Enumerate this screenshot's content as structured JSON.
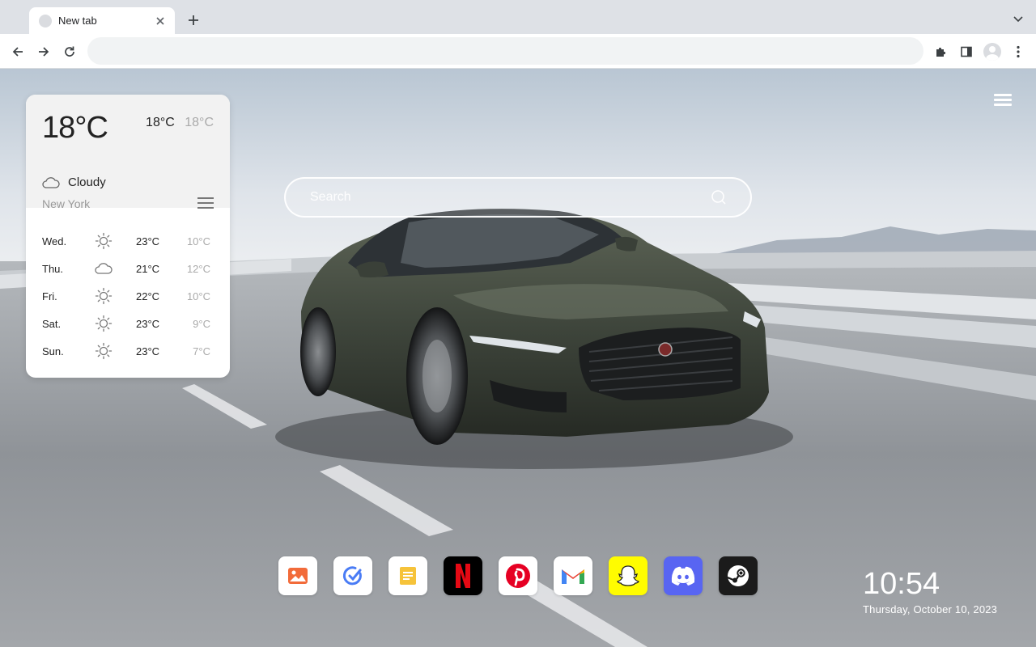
{
  "browser": {
    "tab": {
      "title": "New tab"
    },
    "omnibox": {
      "value": "",
      "placeholder": ""
    }
  },
  "weather": {
    "temp": "18°C",
    "high": "18°C",
    "low": "18°C",
    "condition": "Cloudy",
    "city": "New York",
    "forecast": [
      {
        "day": "Wed.",
        "icon": "sun-icon",
        "high": "23°C",
        "low": "10°C"
      },
      {
        "day": "Thu.",
        "icon": "cloud-icon",
        "high": "21°C",
        "low": "12°C"
      },
      {
        "day": "Fri.",
        "icon": "sun-icon",
        "high": "22°C",
        "low": "10°C"
      },
      {
        "day": "Sat.",
        "icon": "sun-icon",
        "high": "23°C",
        "low": "9°C"
      },
      {
        "day": "Sun.",
        "icon": "sun-icon",
        "high": "23°C",
        "low": "7°C"
      }
    ]
  },
  "search": {
    "placeholder": "Search"
  },
  "dock": {
    "apps": [
      {
        "name": "photos",
        "icon": "photo-icon",
        "color": "#ffffff"
      },
      {
        "name": "tasks",
        "icon": "check-icon",
        "color": "#ffffff"
      },
      {
        "name": "notes",
        "icon": "notes-icon",
        "color": "#ffffff"
      },
      {
        "name": "netflix",
        "icon": "netflix-icon",
        "color": "#000000"
      },
      {
        "name": "pinterest",
        "icon": "pinterest-icon",
        "color": "#ffffff"
      },
      {
        "name": "gmail",
        "icon": "gmail-icon",
        "color": "#ffffff"
      },
      {
        "name": "snapchat",
        "icon": "snapchat-icon",
        "color": "#fffc00"
      },
      {
        "name": "discord",
        "icon": "discord-icon",
        "color": "#5865f2"
      },
      {
        "name": "steam",
        "icon": "steam-icon",
        "color": "#1b1b1b"
      }
    ]
  },
  "clock": {
    "time": "10:54",
    "date": "Thursday, October 10, 2023"
  }
}
